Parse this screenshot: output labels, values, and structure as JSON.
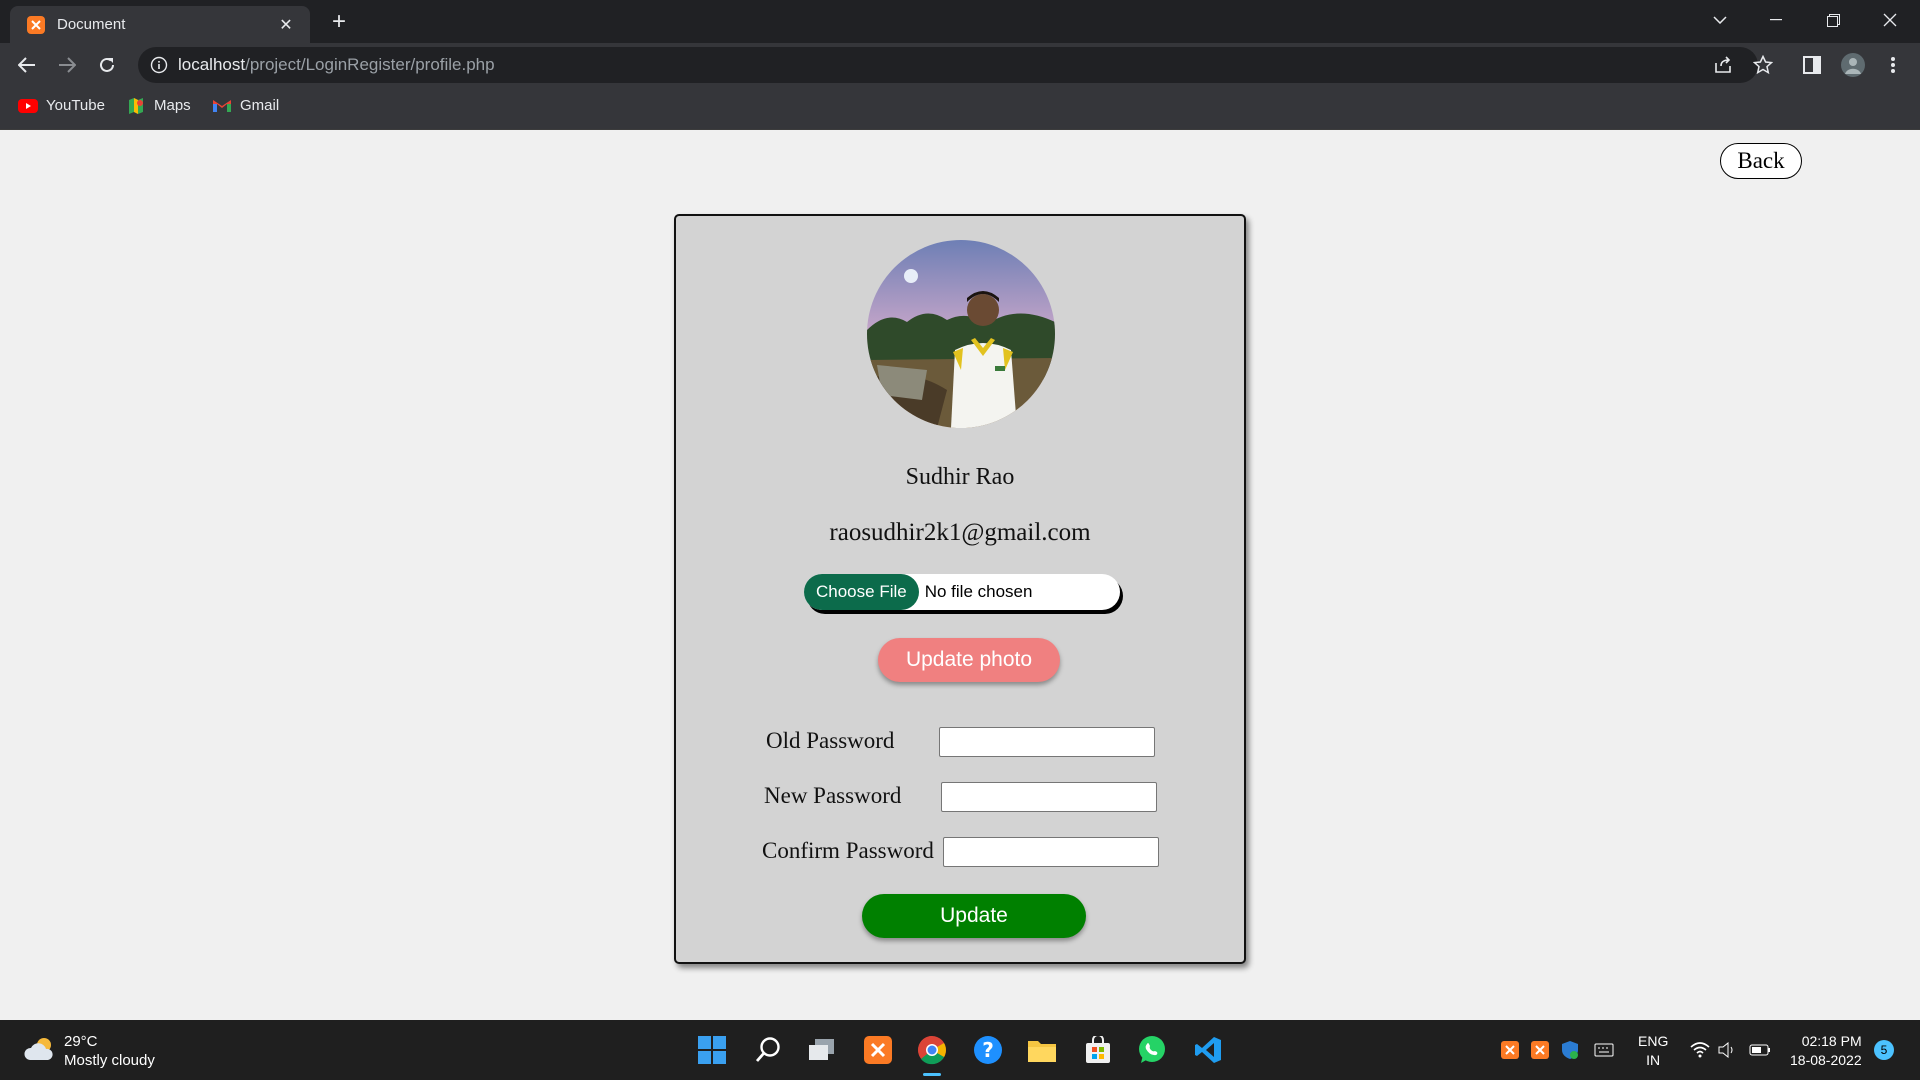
{
  "browser": {
    "tab_title": "Document",
    "url_host": "localhost",
    "url_path": "/project/LoginRegister/profile.php",
    "bookmarks": [
      {
        "label": "YouTube",
        "icon": "youtube-icon"
      },
      {
        "label": "Maps",
        "icon": "maps-icon"
      },
      {
        "label": "Gmail",
        "icon": "gmail-icon"
      }
    ]
  },
  "page": {
    "back_label": "Back",
    "user_name": "Sudhir Rao",
    "user_email": "raosudhir2k1@gmail.com",
    "choose_file_label": "Choose File",
    "file_status": "No file chosen",
    "update_photo_label": "Update photo",
    "old_password_label": "Old Password",
    "new_password_label": "New Password",
    "confirm_password_label": "Confirm Password",
    "update_label": "Update"
  },
  "taskbar": {
    "temperature": "29°C",
    "weather": "Mostly cloudy",
    "lang_line1": "ENG",
    "lang_line2": "IN",
    "time": "02:18 PM",
    "date": "18-08-2022",
    "notification_count": "5"
  },
  "colors": {
    "card_bg": "#d3d3d3",
    "update_photo_bg": "#f08080",
    "update_bg": "#008000",
    "choose_file_bg": "#0c6b4b"
  }
}
